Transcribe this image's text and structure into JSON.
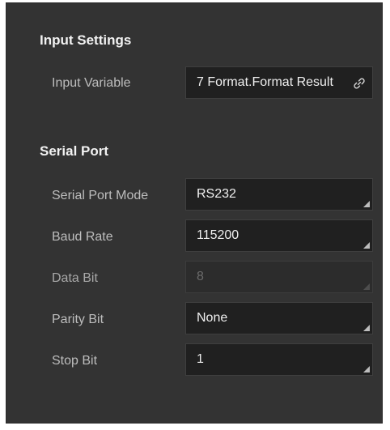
{
  "input_settings": {
    "title": "Input Settings",
    "input_variable": {
      "label": "Input Variable",
      "value": "7 Format.Format Result",
      "icon": "link-icon"
    }
  },
  "serial_port": {
    "title": "Serial Port",
    "fields": {
      "mode": {
        "label": "Serial Port Mode",
        "value": "RS232"
      },
      "baud_rate": {
        "label": "Baud Rate",
        "value": "115200"
      },
      "data_bit": {
        "label": "Data Bit",
        "value": "8",
        "disabled": true
      },
      "parity_bit": {
        "label": "Parity Bit",
        "value": "None"
      },
      "stop_bit": {
        "label": "Stop Bit",
        "value": "1"
      }
    }
  },
  "colors": {
    "panel_background": "#333333",
    "field_background": "#202020",
    "label_text": "#bdbdbd",
    "value_text": "#efefef",
    "disabled_text": "#6b6b6b"
  }
}
